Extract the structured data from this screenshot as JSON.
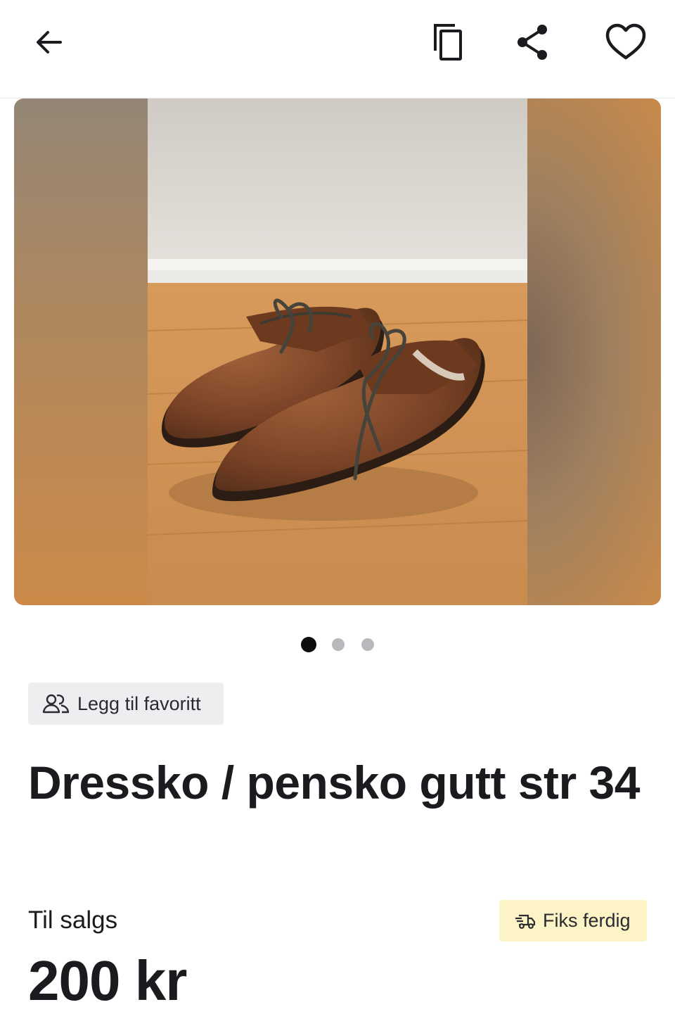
{
  "topbar": {
    "back_icon": "arrow-left-icon",
    "copy_icon": "copy-icon",
    "share_icon": "share-icon",
    "favorite_icon": "heart-icon"
  },
  "gallery": {
    "image_count": 3,
    "active_index": 0
  },
  "favorite_button": {
    "label": "Legg til favoritt",
    "icon": "people-icon"
  },
  "listing": {
    "title": "Dressko / pensko gutt str 34",
    "status": "Til salgs",
    "price": "200 kr",
    "shipping_badge": {
      "label": "Fiks ferdig",
      "icon": "truck-icon",
      "color": "#fcf3c6"
    }
  },
  "colors": {
    "accent_green": "#0f8a5f",
    "text": "#1b1b1f"
  }
}
